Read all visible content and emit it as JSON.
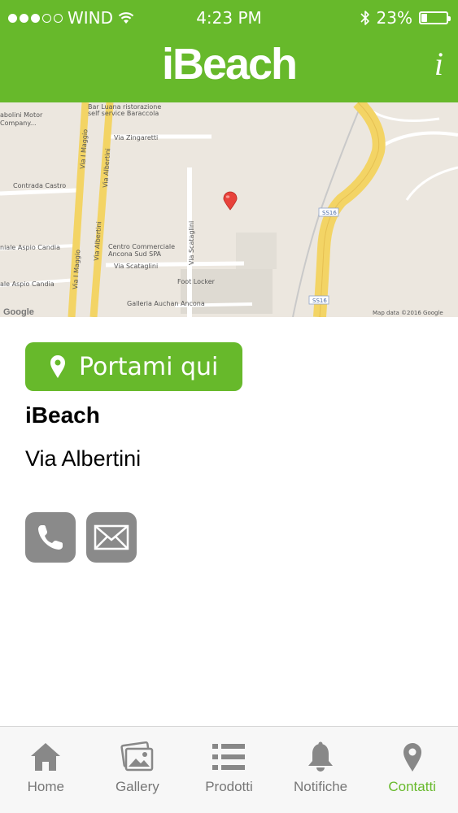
{
  "status_bar": {
    "carrier": "WIND",
    "time": "4:23 PM",
    "battery": "23%",
    "battery_level": 0.23,
    "signal_bars_filled": 3,
    "signal_bars_total": 5
  },
  "header": {
    "title": "iBeach",
    "info_label": "i"
  },
  "map": {
    "streets": {
      "zingaretti": "Via Zingaretti",
      "contrada_castro": "Contrada Castro",
      "maggio_top": "Via I Maggio",
      "albertini_top": "Via Albertini",
      "maggio_bottom": "Via I Maggio",
      "albertini_bottom": "Via Albertini",
      "scataglini": "Via Scataglini",
      "scataglini_vertical": "Via Scataglini",
      "aspio_candia_1": "niale Aspio Candia",
      "aspio_candia_2": "ale Aspio Candia",
      "ss16_top": "SS16",
      "ss16_bottom": "SS16"
    },
    "places": {
      "motor_line1": "abolini Motor",
      "motor_line2": "Company...",
      "bar_line1": "Bar Luana ristorazione",
      "bar_line2": "self service Baraccola",
      "centro_line1": "Centro Commerciale",
      "centro_line2": "Ancona Sud SPA",
      "foot_locker": "Foot Locker",
      "galleria": "Galleria Auchan Ancona"
    },
    "attribution": "Map data ©2016 Google",
    "logo": "Google"
  },
  "content": {
    "nav_button_label": "Portami qui",
    "place_name": "iBeach",
    "address": "Via Albertini"
  },
  "tabs": [
    {
      "label": "Home",
      "icon": "home-icon",
      "active": false
    },
    {
      "label": "Gallery",
      "icon": "gallery-icon",
      "active": false
    },
    {
      "label": "Prodotti",
      "icon": "list-icon",
      "active": false
    },
    {
      "label": "Notifiche",
      "icon": "bell-icon",
      "active": false
    },
    {
      "label": "Contatti",
      "icon": "location-pin-icon",
      "active": true
    }
  ],
  "colors": {
    "accent": "#67b92b",
    "tab_inactive": "#777777",
    "contact_button": "#8a8a8a"
  }
}
